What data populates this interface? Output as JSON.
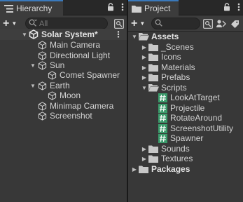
{
  "hierarchy": {
    "tab_label": "Hierarchy",
    "search_placeholder": "All",
    "add_button": "+",
    "scene": "Solar System*",
    "items": [
      {
        "label": "Main Camera"
      },
      {
        "label": "Directional Light"
      },
      {
        "label": "Sun"
      },
      {
        "label": "Comet Spawner"
      },
      {
        "label": "Earth"
      },
      {
        "label": "Moon"
      },
      {
        "label": "Minimap Camera"
      },
      {
        "label": "Screenshot"
      }
    ]
  },
  "project": {
    "tab_label": "Project",
    "add_button": "+",
    "assets_label": "Assets",
    "folders": [
      {
        "label": "_Scenes"
      },
      {
        "label": "Icons"
      },
      {
        "label": "Materials"
      },
      {
        "label": "Prefabs"
      },
      {
        "label": "Scripts"
      }
    ],
    "scripts": [
      {
        "label": "LookAtTarget"
      },
      {
        "label": "Projectile"
      },
      {
        "label": "RotateAround"
      },
      {
        "label": "ScreenshotUtility"
      },
      {
        "label": "Spawner"
      }
    ],
    "folders_after": [
      {
        "label": "Sounds"
      },
      {
        "label": "Textures"
      }
    ],
    "packages_label": "Packages"
  },
  "colors": {
    "panel_bg": "#383838",
    "tab_accent": "#3a79bb",
    "script_icon": "#3a9a6a"
  }
}
